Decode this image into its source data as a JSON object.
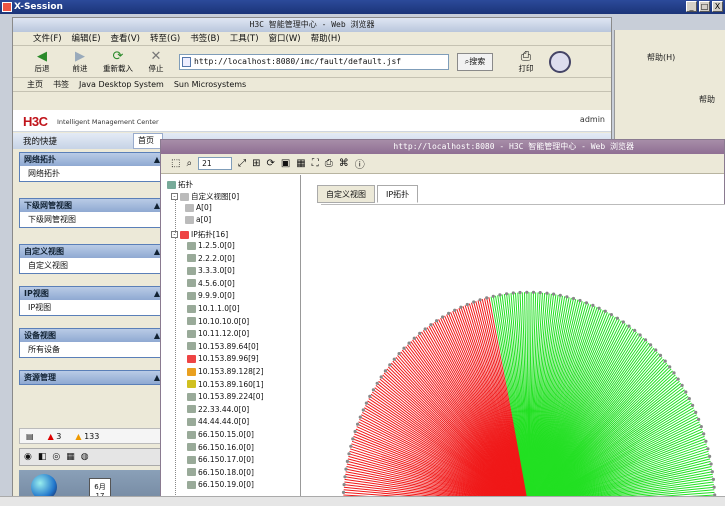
{
  "xsession": {
    "title": "X-Session",
    "controls": [
      "_",
      "□",
      "X"
    ]
  },
  "browser": {
    "title": "H3C 智能管理中心 - Web 浏览器",
    "menu": [
      "文件(F)",
      "编辑(E)",
      "查看(V)",
      "转至(G)",
      "书签(B)",
      "工具(T)",
      "窗口(W)",
      "帮助(H)"
    ],
    "toolbar": {
      "back": "后退",
      "forward": "前进",
      "reload": "重新载入",
      "stop": "停止",
      "search": "搜索",
      "print": "打印"
    },
    "url": "http://localhost:8080/imc/fault/default.jsf",
    "bookmarks": [
      "主页",
      "书签",
      "Java Desktop System",
      "Sun Microsystems"
    ]
  },
  "imc": {
    "logo": "H3C",
    "logo_sub": "Intelligent Management Center",
    "user": "admin",
    "favorites": "我的快捷",
    "home_tab": "首页",
    "sections": [
      {
        "title": "网络拓扑",
        "item": "网络拓扑"
      },
      {
        "title": "下级网管视图",
        "item": "下级网管视图"
      },
      {
        "title": "自定义视图",
        "item": "自定义视图"
      },
      {
        "title": "IP视图",
        "item": "IP视图"
      },
      {
        "title": "设备视图",
        "item": "所有设备"
      },
      {
        "title": "资源管理",
        "item": ""
      }
    ],
    "alarms": {
      "critical": "3",
      "major": "133"
    }
  },
  "right_pane": {
    "help1": "帮助(H)",
    "help2": "帮助"
  },
  "popup": {
    "title": "http://localhost:8080 - H3C 智能管理中心 - Web 浏览器",
    "zoom": "21",
    "tabs": [
      "自定义视图",
      "IP拓扑"
    ],
    "tree": {
      "root": "拓扑",
      "custom": "自定义视图[0]",
      "custom_children": [
        "A[0]",
        "a[0]"
      ],
      "ip": "IP拓扑[16]",
      "ip_children": [
        "1.2.5.0[0]",
        "2.2.2.0[0]",
        "3.3.3.0[0]",
        "4.5.6.0[0]",
        "9.9.9.0[0]",
        "10.1.1.0[0]",
        "10.10.10.0[0]",
        "10.11.12.0[0]",
        "10.153.89.64[0]",
        "10.153.89.96[9]",
        "10.153.89.128[2]",
        "10.153.89.160[1]",
        "10.153.89.224[0]",
        "22.33.44.0[0]",
        "44.44.44.0[0]",
        "66.150.15.0[0]",
        "66.150.16.0[0]",
        "66.150.17.0[0]",
        "66.150.18.0[0]",
        "66.150.19.0[0]"
      ]
    },
    "fan_colors": {
      "red": "#f01818",
      "green": "#22e022"
    }
  },
  "taskbar": {
    "cal_month": "6月",
    "cal_day": "17"
  }
}
